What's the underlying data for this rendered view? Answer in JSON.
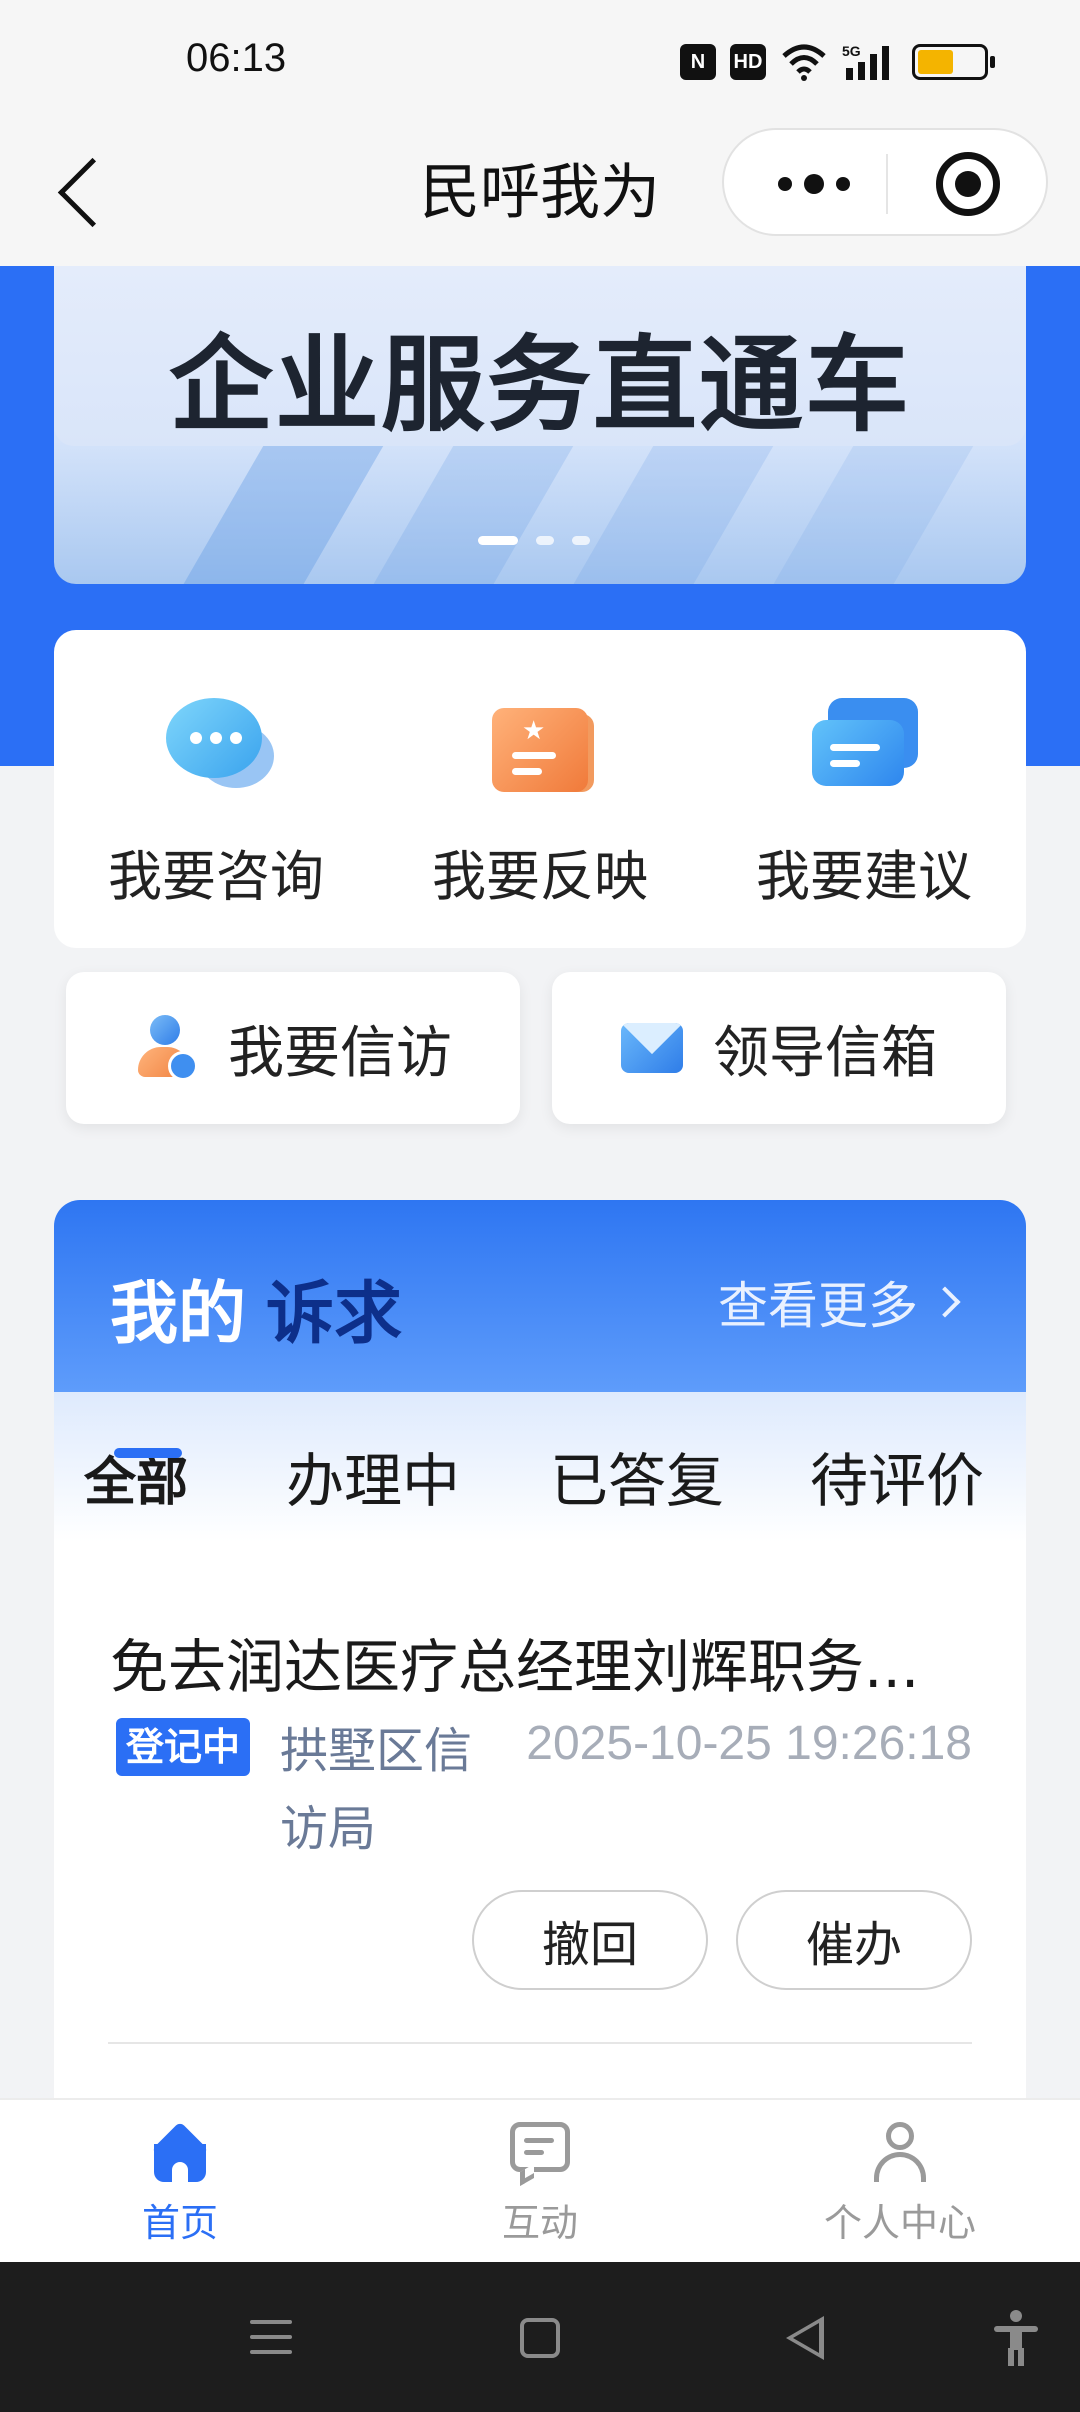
{
  "status_bar": {
    "time": "06:13",
    "icons": [
      "nfc-icon",
      "hd-icon",
      "wifi-icon",
      "5g-signal-icon",
      "battery-icon"
    ],
    "nfc": "N",
    "hd": "HD",
    "battery_level": 0.55
  },
  "title_bar": {
    "title": "民呼我为"
  },
  "banner": {
    "text": "企业服务直通车",
    "slide_count": 3,
    "active_slide": 1
  },
  "services": [
    {
      "label": "我要咨询",
      "icon": "chat-bubble-icon"
    },
    {
      "label": "我要反映",
      "icon": "document-icon"
    },
    {
      "label": "我要建议",
      "icon": "message-card-icon"
    }
  ],
  "quick_actions": [
    {
      "label": "我要信访",
      "icon": "person-check-icon"
    },
    {
      "label": "领导信箱",
      "icon": "mail-icon"
    }
  ],
  "my_appeals": {
    "title_prefix": "我的",
    "title_emphasis": "诉求",
    "view_more": "查看更多",
    "tabs": [
      "全部",
      "办理中",
      "已答复",
      "待评价"
    ],
    "active_tab": 0,
    "items": [
      {
        "title": "免去润达医疗总经理刘辉职务...",
        "status": "登记中",
        "department": "拱墅区信访局",
        "time": "2025-10-25 19:26:18",
        "actions": [
          "撤回",
          "催办"
        ]
      }
    ]
  },
  "bottom_nav": {
    "items": [
      {
        "label": "首页",
        "icon": "home-icon",
        "active": true
      },
      {
        "label": "互动",
        "icon": "chat-icon",
        "active": false
      },
      {
        "label": "个人中心",
        "icon": "user-icon",
        "active": false
      }
    ]
  },
  "colors": {
    "primary": "#2b6ff5",
    "badge": "#2b6ff5",
    "battery": "#f4b400"
  }
}
